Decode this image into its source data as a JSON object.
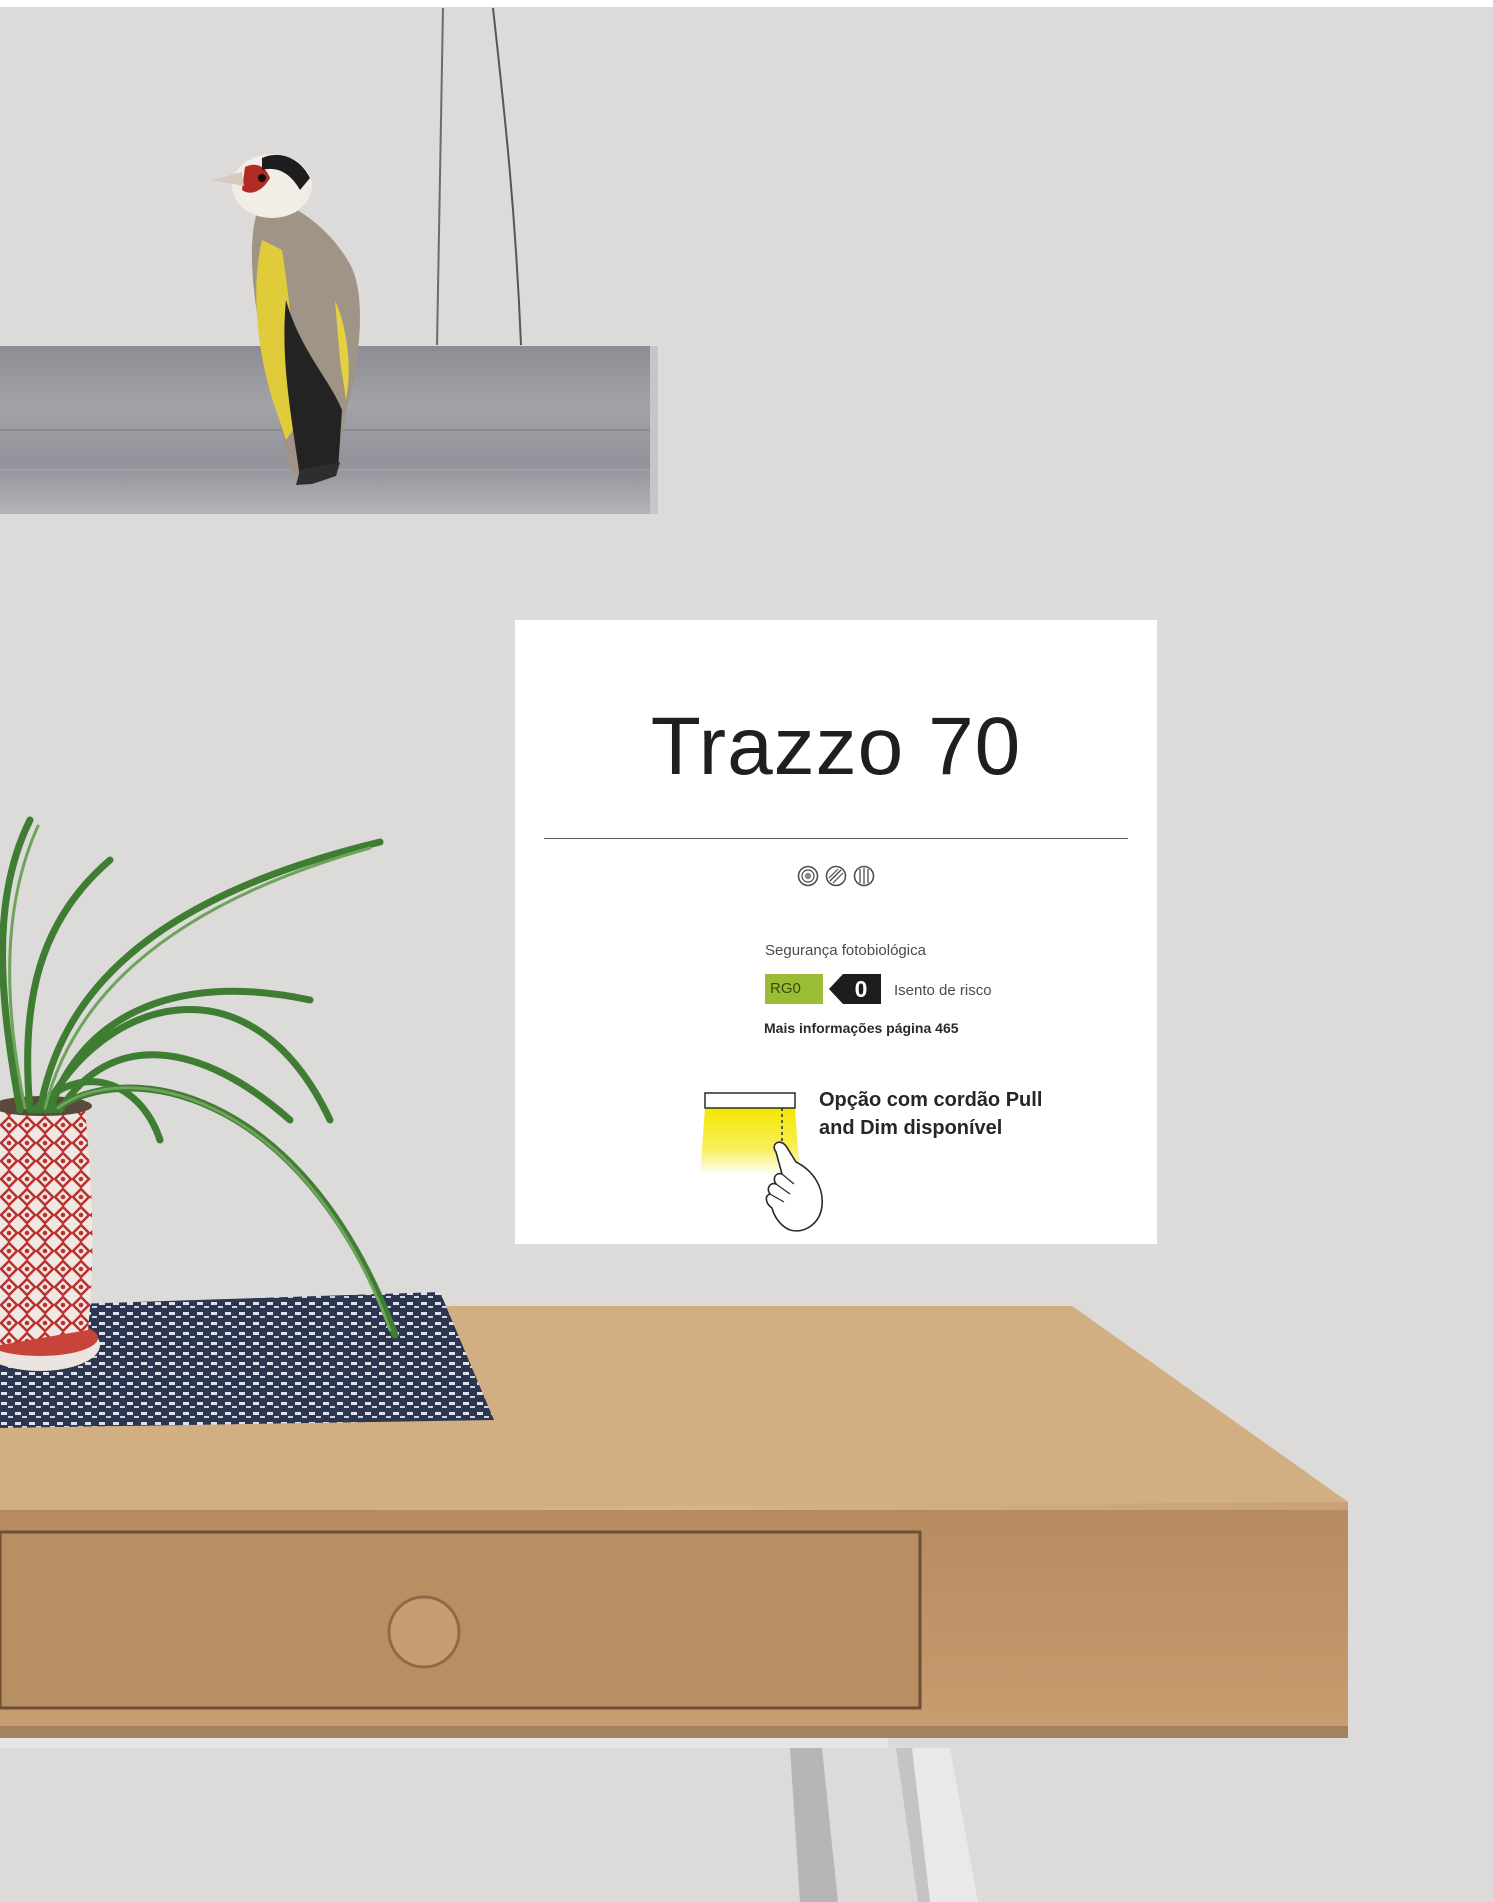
{
  "product": {
    "name": "Trazzo 70"
  },
  "certification_icons": [
    "class-ii-icon",
    "slash-circle-icon",
    "bars-circle-icon"
  ],
  "photobiological": {
    "label": "Segurança fotobiológica",
    "group": "RG0",
    "group_level": "0",
    "description": "Isento de risco",
    "group_color": "#9bbd35"
  },
  "more_info": "Mais informações página 465",
  "pull_and_dim": {
    "text_line1": "Opção com cordão Pull",
    "text_line2": "and Dim disponível",
    "icon": "hand-pull-cord-icon"
  }
}
